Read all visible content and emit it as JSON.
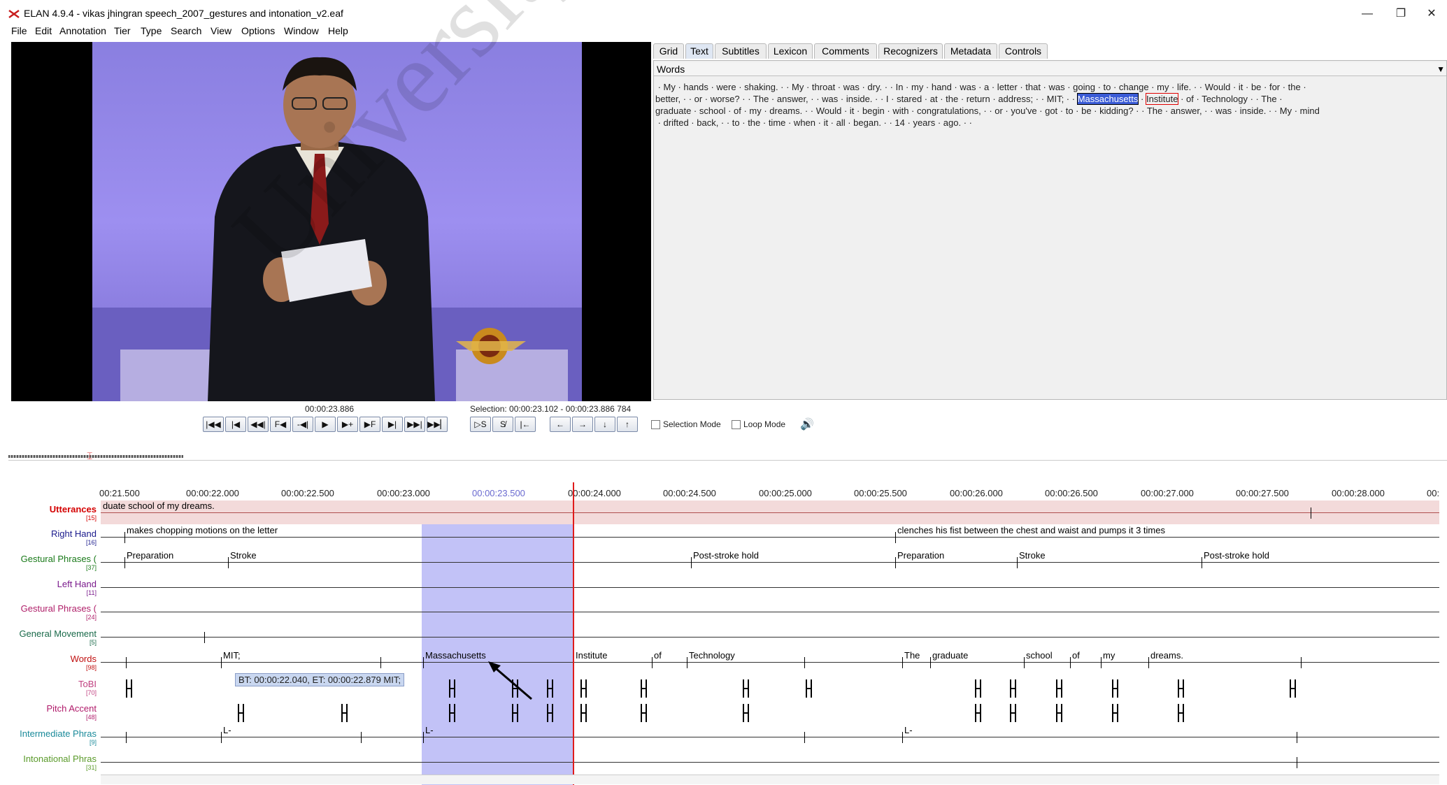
{
  "window": {
    "title": "ELAN 4.9.4 - vikas jhingran speech_2007_gestures and intonation_v2.eaf",
    "minimize": "—",
    "restore": "❐",
    "close": "✕"
  },
  "menu": [
    "File",
    "Edit",
    "Annotation",
    "Tier",
    "Type",
    "Search",
    "View",
    "Options",
    "Window",
    "Help"
  ],
  "tabs": [
    "Grid",
    "Text",
    "Subtitles",
    "Lexicon",
    "Comments",
    "Recognizers",
    "Metadata",
    "Controls"
  ],
  "text_view": {
    "tier": "Words",
    "lines": [
      " · My · hands · were · shaking. · · My · throat · was · dry. · · In · my · hand · was · a · letter · that · was · going · to · change · my · life. · · Would · it · be · for · the ·",
      "better, · · or · worse? · · The · answer, · · was · inside. · · I · stared · at · the · return · address; · · MIT; · · ",
      "graduate · school · of · my · dreams. · · Would · it · begin · with · congratulations, · · or · you've · got · to · be · kidding? · · The · answer, · · was · inside. · · My · mind",
      " · drifted · back, · · to · the · time · when · it · all · began. · · 14 · years · ago. · ·"
    ],
    "selected_word": "Massachusetts",
    "boxed_word": "Institute",
    "after_box": " · of · Technology · · The ·"
  },
  "player": {
    "current_time": "00:00:23.886",
    "selection": "Selection: 00:00:23.102 - 00:00:23.886  784",
    "buttons": [
      "|◀◀",
      "|◀",
      "◀◀|",
      "F◀",
      "-◀|",
      "▶",
      "▶+",
      "▶F",
      "▶|",
      "▶▶|",
      "▶▶▏",
      "▷S",
      "S̸",
      "|←",
      "←",
      "→",
      "↓",
      "↑"
    ],
    "selection_mode": "Selection Mode",
    "loop_mode": "Loop Mode"
  },
  "ruler": [
    "00:21.500",
    "00:00:22.000",
    "00:00:22.500",
    "00:00:23.000",
    "00:00:23.500",
    "00:00:24.000",
    "00:00:24.500",
    "00:00:25.000",
    "00:00:25.500",
    "00:00:26.000",
    "00:00:26.500",
    "00:00:27.000",
    "00:00:27.500",
    "00:00:28.000",
    "00:"
  ],
  "tiers": [
    {
      "name": "Utterances",
      "count": "[15]",
      "color": "#d40000"
    },
    {
      "name": "Right Hand",
      "count": "[16]",
      "color": "#1a1a8c"
    },
    {
      "name": "Gestural Phrases (",
      "count": "[37]",
      "color": "#1a7a1a"
    },
    {
      "name": "Left Hand",
      "count": "[11]",
      "color": "#7a1a8c"
    },
    {
      "name": "Gestural Phrases (",
      "count": "[24]",
      "color": "#b0206a"
    },
    {
      "name": "General Movement",
      "count": "[5]",
      "color": "#1a6a4a"
    },
    {
      "name": "Words",
      "count": "[98]",
      "color": "#c01010"
    },
    {
      "name": "ToBI",
      "count": "[70]",
      "color": "#c04080"
    },
    {
      "name": "Pitch Accent",
      "count": "[48]",
      "color": "#b01a6a"
    },
    {
      "name": "Intermediate Phras",
      "count": "[9]",
      "color": "#1a8a9a"
    },
    {
      "name": "Intonational Phras",
      "count": "[31]",
      "color": "#5a9a2a"
    }
  ],
  "annotations": {
    "utterance": "duate school of my dreams.",
    "right_hand": [
      "makes chopping motions on the letter",
      "clenches his fist between the chest and waist and pumps it 3 times"
    ],
    "gestural_phrases": [
      "Preparation",
      "Stroke",
      "Post-stroke hold",
      "Preparation",
      "Stroke",
      "Post-stroke hold"
    ],
    "words": [
      "MIT;",
      "Massachusetts",
      "Institute",
      "of",
      "Technology",
      "The",
      "graduate",
      "school",
      "of",
      "my",
      "dreams."
    ],
    "intermediate": [
      "L-",
      "L-",
      "L-"
    ]
  },
  "tooltip": "BT: 00:00:22.040, ET: 00:00:22.879 MIT;",
  "watermark": "University of Malaya"
}
